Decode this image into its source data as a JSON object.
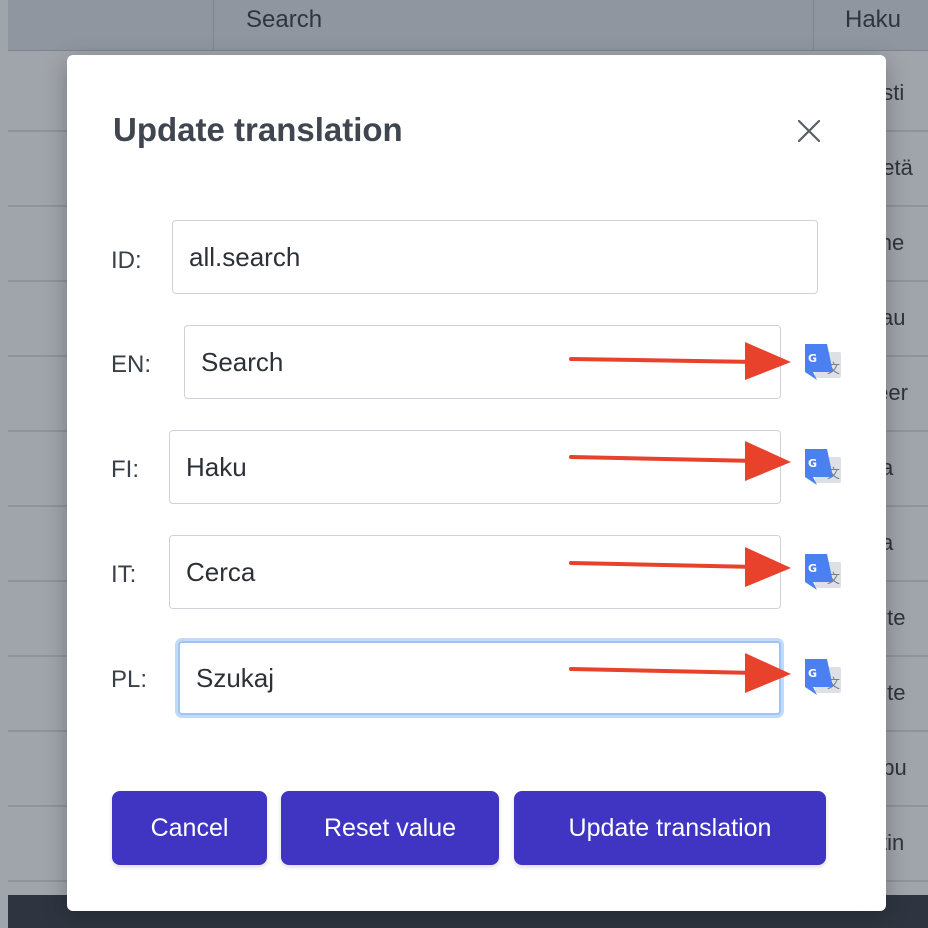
{
  "background": {
    "header": {
      "col_en": "Search",
      "col_fi": "Haku"
    },
    "rows": [
      "esti",
      "netä",
      "line",
      "vau",
      "teer",
      "ita",
      "ita",
      "oite",
      "oite",
      "upu",
      "stin"
    ]
  },
  "modal": {
    "title": "Update translation",
    "close_icon": "close-icon",
    "fields": [
      {
        "label": "ID:",
        "value": "all.search"
      },
      {
        "label": "EN:",
        "value": "Search"
      },
      {
        "label": "FI:",
        "value": "Haku"
      },
      {
        "label": "IT:",
        "value": "Cerca"
      },
      {
        "label": "PL:",
        "value": "Szukaj"
      }
    ],
    "translate_icon": "google-translate-icon",
    "buttons": {
      "cancel": "Cancel",
      "reset": "Reset value",
      "update": "Update translation"
    }
  },
  "colors": {
    "button_bg": "#3f35c2",
    "arrow": "#e8412c",
    "translate_blue": "#4a80f0"
  }
}
